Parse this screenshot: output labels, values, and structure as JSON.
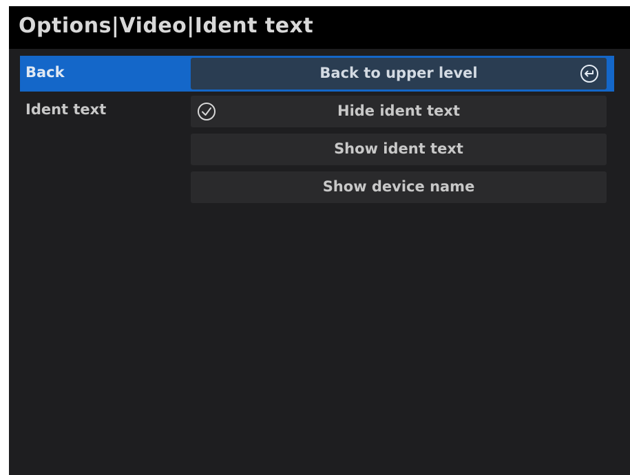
{
  "header": {
    "title": "Options|Video|Ident text"
  },
  "rows": {
    "back_label": "Back",
    "ident_label": "Ident text"
  },
  "options": {
    "back_to_upper": "Back to upper level",
    "hide_ident": "Hide ident text",
    "show_ident": "Show ident text",
    "show_device": "Show device name"
  },
  "state": {
    "selected_option": "Hide ident text"
  },
  "icons": {
    "back": "return-arrow-icon",
    "selected": "checkmark-circle-icon"
  },
  "colors": {
    "highlight": "#1467c9",
    "background": "#1e1e20",
    "title_bar": "#000000",
    "option_bg": "#2a2a2c"
  }
}
